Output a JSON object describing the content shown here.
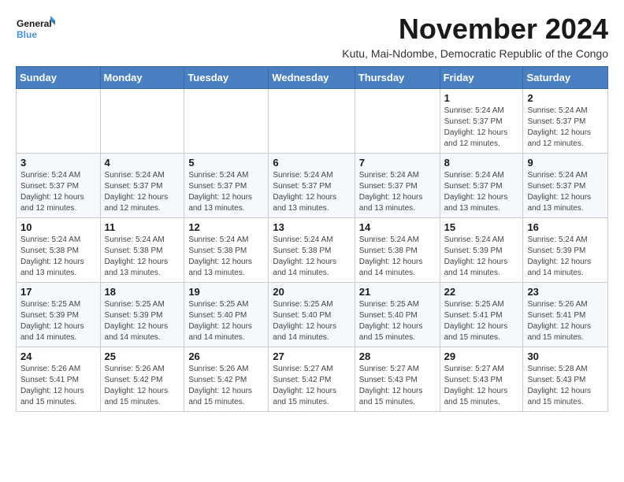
{
  "logo": {
    "text_general": "General",
    "text_blue": "Blue"
  },
  "header": {
    "month_title": "November 2024",
    "subtitle": "Kutu, Mai-Ndombe, Democratic Republic of the Congo"
  },
  "weekdays": [
    "Sunday",
    "Monday",
    "Tuesday",
    "Wednesday",
    "Thursday",
    "Friday",
    "Saturday"
  ],
  "weeks": [
    [
      {
        "day": "",
        "info": ""
      },
      {
        "day": "",
        "info": ""
      },
      {
        "day": "",
        "info": ""
      },
      {
        "day": "",
        "info": ""
      },
      {
        "day": "",
        "info": ""
      },
      {
        "day": "1",
        "info": "Sunrise: 5:24 AM\nSunset: 5:37 PM\nDaylight: 12 hours\nand 12 minutes."
      },
      {
        "day": "2",
        "info": "Sunrise: 5:24 AM\nSunset: 5:37 PM\nDaylight: 12 hours\nand 12 minutes."
      }
    ],
    [
      {
        "day": "3",
        "info": "Sunrise: 5:24 AM\nSunset: 5:37 PM\nDaylight: 12 hours\nand 12 minutes."
      },
      {
        "day": "4",
        "info": "Sunrise: 5:24 AM\nSunset: 5:37 PM\nDaylight: 12 hours\nand 12 minutes."
      },
      {
        "day": "5",
        "info": "Sunrise: 5:24 AM\nSunset: 5:37 PM\nDaylight: 12 hours\nand 13 minutes."
      },
      {
        "day": "6",
        "info": "Sunrise: 5:24 AM\nSunset: 5:37 PM\nDaylight: 12 hours\nand 13 minutes."
      },
      {
        "day": "7",
        "info": "Sunrise: 5:24 AM\nSunset: 5:37 PM\nDaylight: 12 hours\nand 13 minutes."
      },
      {
        "day": "8",
        "info": "Sunrise: 5:24 AM\nSunset: 5:37 PM\nDaylight: 12 hours\nand 13 minutes."
      },
      {
        "day": "9",
        "info": "Sunrise: 5:24 AM\nSunset: 5:37 PM\nDaylight: 12 hours\nand 13 minutes."
      }
    ],
    [
      {
        "day": "10",
        "info": "Sunrise: 5:24 AM\nSunset: 5:38 PM\nDaylight: 12 hours\nand 13 minutes."
      },
      {
        "day": "11",
        "info": "Sunrise: 5:24 AM\nSunset: 5:38 PM\nDaylight: 12 hours\nand 13 minutes."
      },
      {
        "day": "12",
        "info": "Sunrise: 5:24 AM\nSunset: 5:38 PM\nDaylight: 12 hours\nand 13 minutes."
      },
      {
        "day": "13",
        "info": "Sunrise: 5:24 AM\nSunset: 5:38 PM\nDaylight: 12 hours\nand 14 minutes."
      },
      {
        "day": "14",
        "info": "Sunrise: 5:24 AM\nSunset: 5:38 PM\nDaylight: 12 hours\nand 14 minutes."
      },
      {
        "day": "15",
        "info": "Sunrise: 5:24 AM\nSunset: 5:39 PM\nDaylight: 12 hours\nand 14 minutes."
      },
      {
        "day": "16",
        "info": "Sunrise: 5:24 AM\nSunset: 5:39 PM\nDaylight: 12 hours\nand 14 minutes."
      }
    ],
    [
      {
        "day": "17",
        "info": "Sunrise: 5:25 AM\nSunset: 5:39 PM\nDaylight: 12 hours\nand 14 minutes."
      },
      {
        "day": "18",
        "info": "Sunrise: 5:25 AM\nSunset: 5:39 PM\nDaylight: 12 hours\nand 14 minutes."
      },
      {
        "day": "19",
        "info": "Sunrise: 5:25 AM\nSunset: 5:40 PM\nDaylight: 12 hours\nand 14 minutes."
      },
      {
        "day": "20",
        "info": "Sunrise: 5:25 AM\nSunset: 5:40 PM\nDaylight: 12 hours\nand 14 minutes."
      },
      {
        "day": "21",
        "info": "Sunrise: 5:25 AM\nSunset: 5:40 PM\nDaylight: 12 hours\nand 15 minutes."
      },
      {
        "day": "22",
        "info": "Sunrise: 5:25 AM\nSunset: 5:41 PM\nDaylight: 12 hours\nand 15 minutes."
      },
      {
        "day": "23",
        "info": "Sunrise: 5:26 AM\nSunset: 5:41 PM\nDaylight: 12 hours\nand 15 minutes."
      }
    ],
    [
      {
        "day": "24",
        "info": "Sunrise: 5:26 AM\nSunset: 5:41 PM\nDaylight: 12 hours\nand 15 minutes."
      },
      {
        "day": "25",
        "info": "Sunrise: 5:26 AM\nSunset: 5:42 PM\nDaylight: 12 hours\nand 15 minutes."
      },
      {
        "day": "26",
        "info": "Sunrise: 5:26 AM\nSunset: 5:42 PM\nDaylight: 12 hours\nand 15 minutes."
      },
      {
        "day": "27",
        "info": "Sunrise: 5:27 AM\nSunset: 5:42 PM\nDaylight: 12 hours\nand 15 minutes."
      },
      {
        "day": "28",
        "info": "Sunrise: 5:27 AM\nSunset: 5:43 PM\nDaylight: 12 hours\nand 15 minutes."
      },
      {
        "day": "29",
        "info": "Sunrise: 5:27 AM\nSunset: 5:43 PM\nDaylight: 12 hours\nand 15 minutes."
      },
      {
        "day": "30",
        "info": "Sunrise: 5:28 AM\nSunset: 5:43 PM\nDaylight: 12 hours\nand 15 minutes."
      }
    ]
  ]
}
